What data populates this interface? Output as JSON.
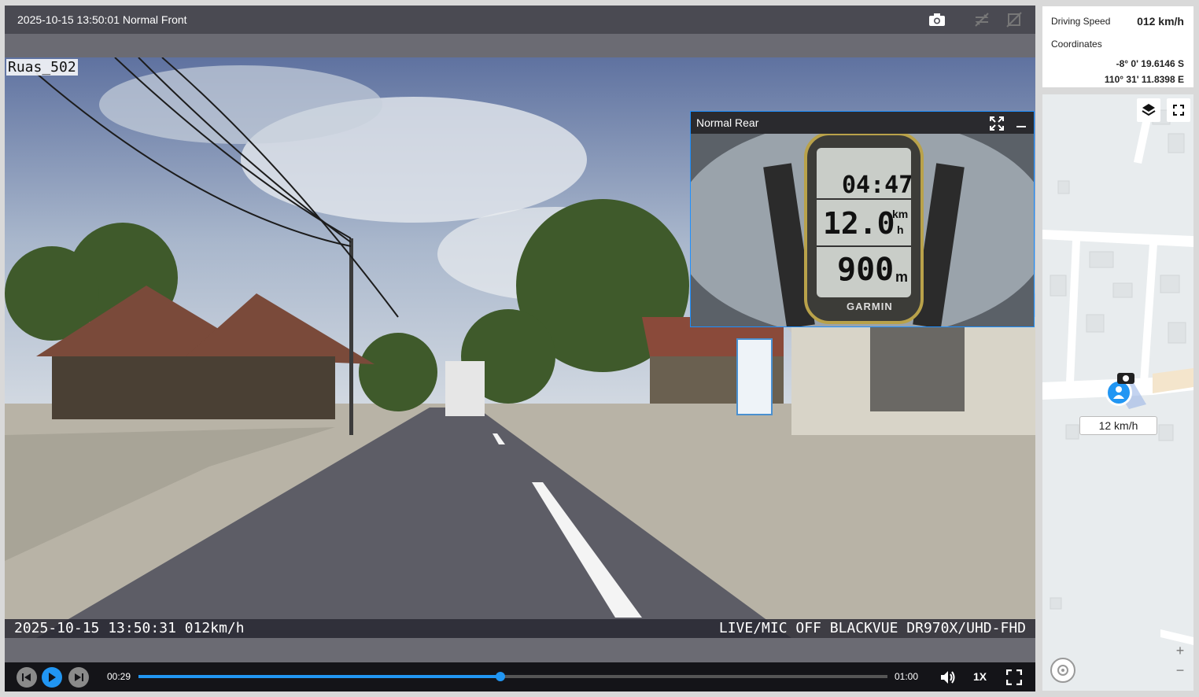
{
  "player": {
    "title": "2025-10-15 13:50:01 Normal Front",
    "osd_label": "Ruas_502",
    "osd_left": "2025-10-15 13:50:31 012km/h",
    "osd_right": "LIVE/MIC OFF BLACKVUE DR970X/UHD-FHD"
  },
  "pip": {
    "title": "Normal Rear",
    "gps_time": "04:47",
    "gps_speed": "12.0",
    "gps_speed_unit_top": "km",
    "gps_speed_unit_bottom": "h",
    "gps_distance": "900",
    "gps_distance_unit": "m",
    "brand": "GARMIN"
  },
  "controls": {
    "current_time": "00:29",
    "total_time": "01:00",
    "progress": 0.483,
    "rate": "1X"
  },
  "info": {
    "speed_label": "Driving Speed",
    "speed_value": "012 km/h",
    "coords_label": "Coordinates",
    "lat": "-8° 0' 19.6146 S",
    "lon": "110° 31' 11.8398 E"
  },
  "map": {
    "speed_badge": "12 km/h",
    "zoom_in": "+",
    "zoom_out": "−"
  },
  "colors": {
    "accent": "#2196f3"
  },
  "icons": [
    "camera-icon",
    "sync-off-icon",
    "fullscreen-icon",
    "minimize-icon",
    "prev-icon",
    "play-icon",
    "next-icon",
    "volume-icon",
    "layers-icon",
    "compass-icon",
    "user-marker-icon"
  ]
}
